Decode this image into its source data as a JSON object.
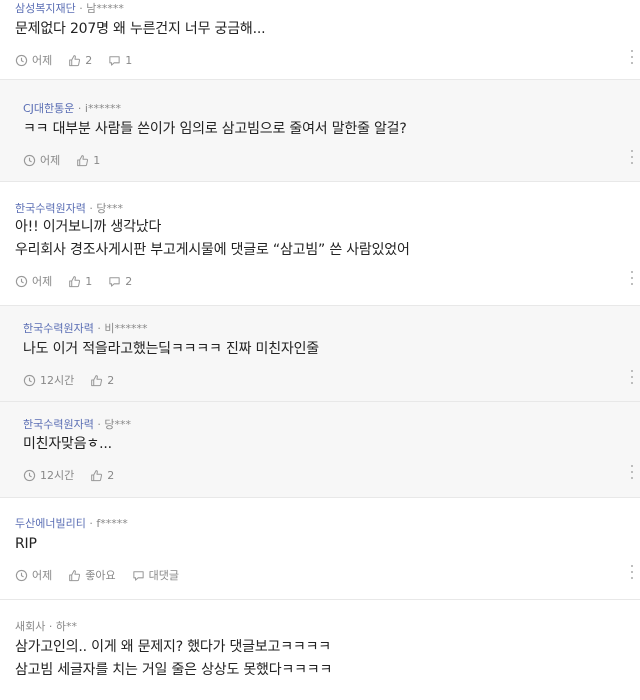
{
  "comments": [
    {
      "company": "삼성복지재단",
      "sep": " · ",
      "user": "남*****",
      "lines": [
        "문제없다 207명 왜 누른건지 너무 궁금해..."
      ],
      "time": "어제",
      "likes": "2",
      "replies": "1"
    },
    {
      "company": "CJ대한통운",
      "sep": " · ",
      "user": "i******",
      "lines": [
        "ㅋㅋ 대부분 사람들 쓴이가 임의로 삼고빔으로 줄여서 말한줄 알걸?"
      ],
      "time": "어제",
      "likes": "1"
    },
    {
      "company": "한국수력원자력",
      "sep": " · ",
      "user": "당***",
      "lines": [
        "아!! 이거보니까 생각났다",
        "우리회사 경조사게시판 부고게시물에 댓글로 “삼고빔” 쓴 사람있었어"
      ],
      "time": "어제",
      "likes": "1",
      "replies": "2"
    },
    {
      "company": "한국수력원자력",
      "sep": " · ",
      "user": "비******",
      "lines": [
        "나도 이거 적을라고했는딬ㅋㅋㅋㅋ 진짜 미친자인줄"
      ],
      "time": "12시간",
      "likes": "2"
    },
    {
      "company": "한국수력원자력",
      "sep": " · ",
      "user": "당***",
      "lines": [
        "미친자맞음ㅎ..."
      ],
      "time": "12시간",
      "likes": "2"
    },
    {
      "company": "두산에너빌리티",
      "sep": " · ",
      "user": "f*****",
      "lines": [
        "RIP"
      ],
      "time": "어제",
      "likes": "좋아요",
      "replies": "대댓글"
    },
    {
      "company": "새회사",
      "sep": " · ",
      "user": "하**",
      "lines": [
        "삼가고인의.. 이게 왜 문제지? 했다가 댓글보고ㅋㅋㅋㅋ",
        "삼고빔 세글자를 치는 거일 줄은 상상도 못했다ㅋㅋㅋㅋ"
      ]
    }
  ]
}
